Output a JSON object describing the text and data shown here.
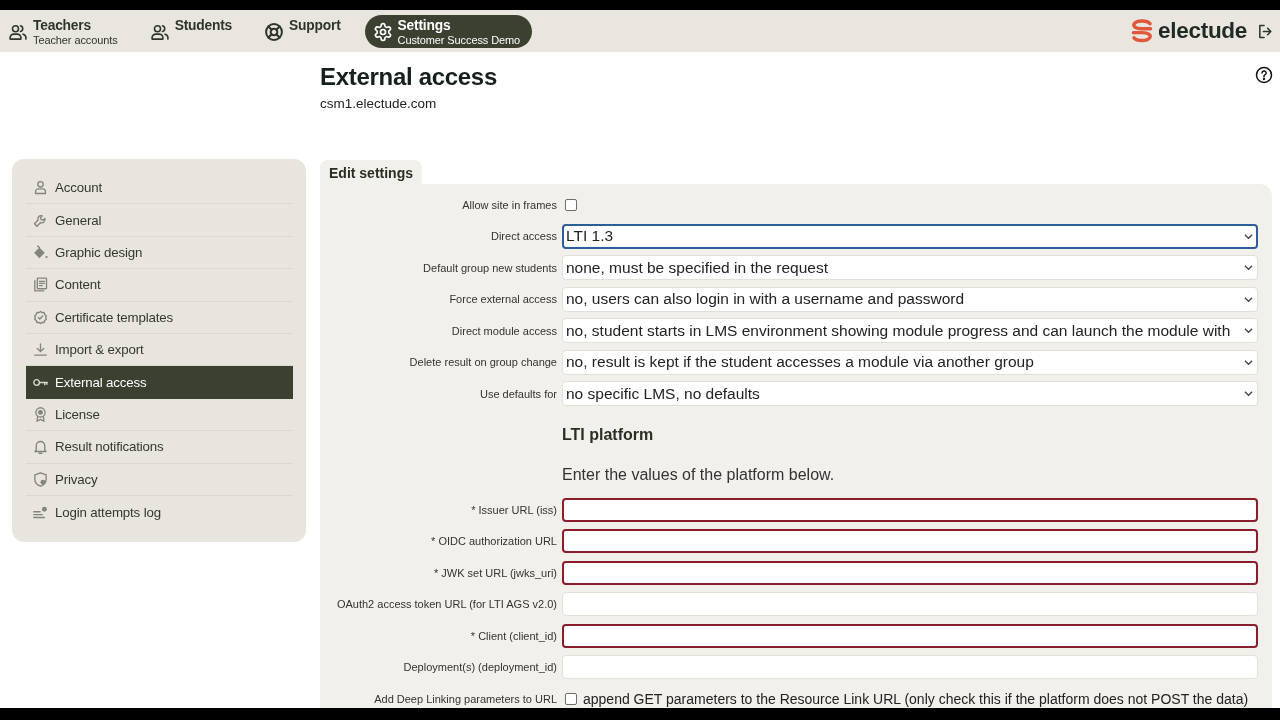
{
  "nav": {
    "items": [
      {
        "title": "Teachers",
        "subtitle": "Teacher accounts",
        "selected": false
      },
      {
        "title": "Students",
        "selected": false
      },
      {
        "title": "Support",
        "selected": false
      },
      {
        "title": "Settings",
        "subtitle": "Customer Success Demo",
        "selected": true
      }
    ]
  },
  "logo": {
    "name": "electude"
  },
  "page": {
    "title": "External access",
    "subtitle": "csm1.electude.com"
  },
  "sidebar": {
    "items": [
      {
        "label": "Account",
        "selected": false
      },
      {
        "label": "General",
        "selected": false
      },
      {
        "label": "Graphic design",
        "selected": false
      },
      {
        "label": "Content",
        "selected": false
      },
      {
        "label": "Certificate templates",
        "selected": false
      },
      {
        "label": "Import & export",
        "selected": false
      },
      {
        "label": "External access",
        "selected": true
      },
      {
        "label": "License",
        "selected": false
      },
      {
        "label": "Result notifications",
        "selected": false
      },
      {
        "label": "Privacy",
        "selected": false
      },
      {
        "label": "Login attempts log",
        "selected": false
      }
    ]
  },
  "form": {
    "tab": "Edit settings",
    "fields": [
      {
        "kind": "checkbox",
        "label": "Allow site in frames",
        "checked": false
      },
      {
        "kind": "select",
        "label": "Direct access",
        "value": "LTI 1.3",
        "focused": true
      },
      {
        "kind": "select",
        "label": "Default group new students",
        "value": "none, must be specified in the request",
        "focused": false
      },
      {
        "kind": "select",
        "label": "Force external access",
        "value": "no, users can also login in with a username and password",
        "focused": false
      },
      {
        "kind": "select",
        "label": "Direct module access",
        "value": "no, student starts in LMS environment showing module progress and can launch the module with",
        "focused": false
      },
      {
        "kind": "select",
        "label": "Delete result on group change",
        "value": "no, result is kept if the student accesses a module via another group",
        "focused": false
      },
      {
        "kind": "select",
        "label": "Use defaults for",
        "value": "no specific LMS, no defaults",
        "focused": false
      }
    ],
    "section": {
      "title": "LTI platform",
      "description": "Enter the values of the platform below."
    },
    "platform_fields": [
      {
        "kind": "text",
        "label": "* Issuer URL (iss)",
        "required": true
      },
      {
        "kind": "text",
        "label": "* OIDC authorization URL",
        "required": true
      },
      {
        "kind": "text",
        "label": "* JWK set URL (jwks_uri)",
        "required": true
      },
      {
        "kind": "text",
        "label": "OAuth2 access token URL (for LTI AGS v2.0)",
        "required": false
      },
      {
        "kind": "text",
        "label": "* Client (client_id)",
        "required": true
      },
      {
        "kind": "text",
        "label": "Deployment(s) (deployment_id)",
        "required": false
      },
      {
        "kind": "checkbox",
        "label": "Add Deep Linking parameters to URL",
        "checked": false,
        "text": "append GET parameters to the Resource Link URL (only check this if the platform does not POST the data)"
      }
    ]
  }
}
